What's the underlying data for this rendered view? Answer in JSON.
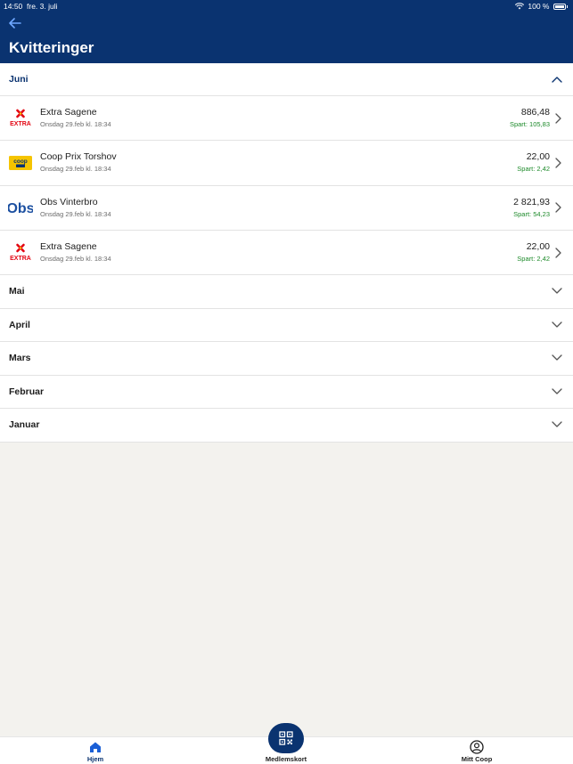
{
  "status_bar": {
    "time": "14:50",
    "date": "fre. 3. juli",
    "battery": "100 %"
  },
  "header": {
    "title": "Kvitteringer"
  },
  "sections": {
    "open_label": "Juni",
    "receipts": [
      {
        "store": "Extra Sagene",
        "date": "Onsdag 29.feb kl. 18:34",
        "amount": "886,48",
        "saved": "Spart: 105,83",
        "logo": "extra-logo",
        "logo_text": "EXTRA"
      },
      {
        "store": "Coop Prix Torshov",
        "date": "Onsdag 29.feb kl. 18:34",
        "amount": "22,00",
        "saved": "Spart: 2,42",
        "logo": "coop-prix-logo",
        "logo_text": "coop"
      },
      {
        "store": "Obs Vinterbro",
        "date": "Onsdag 29.feb kl. 18:34",
        "amount": "2 821,93",
        "saved": "Spart: 54,23",
        "logo": "obs-logo",
        "logo_text": "Obs"
      },
      {
        "store": "Extra Sagene",
        "date": "Onsdag 29.feb kl. 18:34",
        "amount": "22,00",
        "saved": "Spart: 2,42",
        "logo": "extra-logo",
        "logo_text": "EXTRA"
      }
    ],
    "collapsed": [
      "Mai",
      "April",
      "Mars",
      "Februar",
      "Januar"
    ]
  },
  "tabbar": {
    "home": "Hjem",
    "card": "Medlemskort",
    "profile": "Mitt Coop"
  },
  "colors": {
    "brand": "#0a3370",
    "saved": "#1d8a2a",
    "extra_red": "#e30613",
    "coop_yellow": "#f5c400"
  }
}
